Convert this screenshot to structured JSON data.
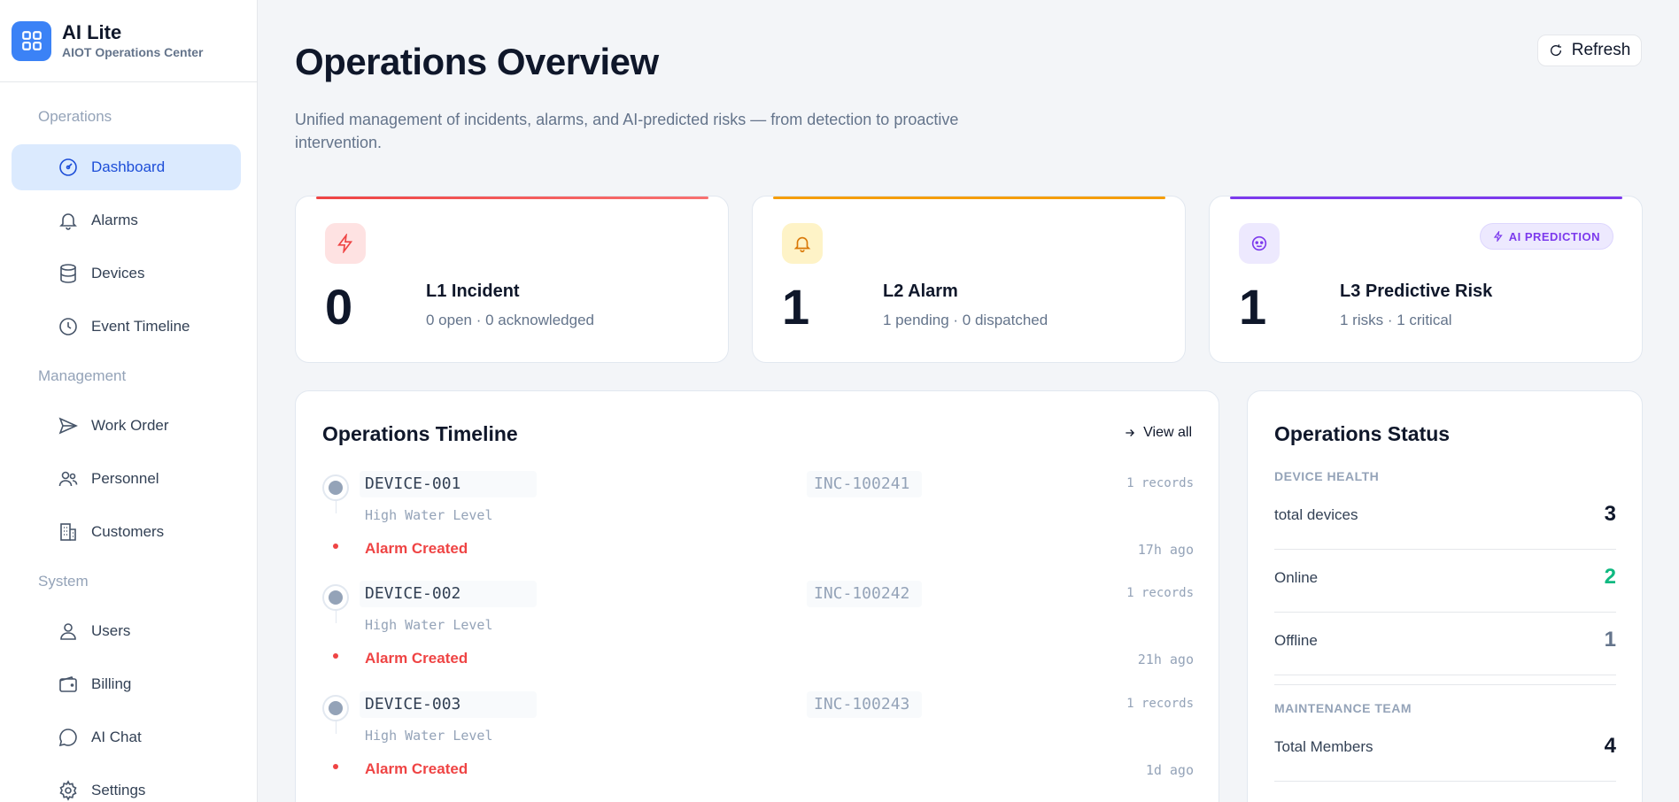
{
  "brand": {
    "title": "AI Lite",
    "subtitle": "AIOT Operations Center",
    "icon": "grid-icon",
    "color": "#3b82f6"
  },
  "sidebar": {
    "sections": [
      {
        "label": "Operations",
        "items": [
          {
            "label": "Dashboard",
            "icon": "dashboard-gauge-icon",
            "active": true
          },
          {
            "label": "Alarms",
            "icon": "bell-icon"
          },
          {
            "label": "Devices",
            "icon": "database-icon"
          },
          {
            "label": "Event Timeline",
            "icon": "clock-icon"
          }
        ]
      },
      {
        "label": "Management",
        "items": [
          {
            "label": "Work Order",
            "icon": "send-icon"
          },
          {
            "label": "Personnel",
            "icon": "users-icon"
          },
          {
            "label": "Customers",
            "icon": "building-icon"
          }
        ]
      },
      {
        "label": "System",
        "items": [
          {
            "label": "Users",
            "icon": "user-icon"
          },
          {
            "label": "Billing",
            "icon": "wallet-icon"
          },
          {
            "label": "AI Chat",
            "icon": "chat-icon"
          },
          {
            "label": "Settings",
            "icon": "gear-icon"
          }
        ]
      }
    ]
  },
  "header": {
    "title": "Operations Overview",
    "description": "Unified management of incidents, alarms, and AI-predicted risks — from detection to proactive intervention.",
    "refresh_label": "Refresh"
  },
  "stats": [
    {
      "value": "0",
      "title": "L1 Incident",
      "subtitle": "0 open · 0 acknowledged",
      "icon": "lightning-icon",
      "accent": "#ef4444"
    },
    {
      "value": "1",
      "title": "L2 Alarm",
      "subtitle": "1 pending · 0 dispatched",
      "icon": "bell-icon",
      "accent": "#f59e0b"
    },
    {
      "value": "1",
      "title": "L3 Predictive Risk",
      "subtitle": "1 risks · 1 critical",
      "icon": "ai-icon",
      "accent": "#7c3aed",
      "badge": "AI PREDICTION"
    }
  ],
  "timeline": {
    "title": "Operations Timeline",
    "view_all_label": "View all",
    "entries": [
      {
        "device": "DEVICE-001",
        "incident": "INC-100241",
        "records": "1 records",
        "description": "High Water Level",
        "event": "Alarm Created",
        "time": "17h ago"
      },
      {
        "device": "DEVICE-002",
        "incident": "INC-100242",
        "records": "1 records",
        "description": "High Water Level",
        "event": "Alarm Created",
        "time": "21h ago"
      },
      {
        "device": "DEVICE-003",
        "incident": "INC-100243",
        "records": "1 records",
        "description": "High Water Level",
        "event": "Alarm Created",
        "time": "1d ago"
      }
    ]
  },
  "status": {
    "title": "Operations Status",
    "device_health_label": "DEVICE HEALTH",
    "device_rows": [
      {
        "label": "total devices",
        "value": "3",
        "color": "#0f172a"
      },
      {
        "label": "Online",
        "value": "2",
        "color": "#10b981"
      },
      {
        "label": "Offline",
        "value": "1",
        "color": "#64748b"
      }
    ],
    "maintenance_label": "MAINTENANCE TEAM",
    "maintenance_rows": [
      {
        "label": "Total Members",
        "value": "4",
        "color": "#0f172a"
      }
    ]
  }
}
